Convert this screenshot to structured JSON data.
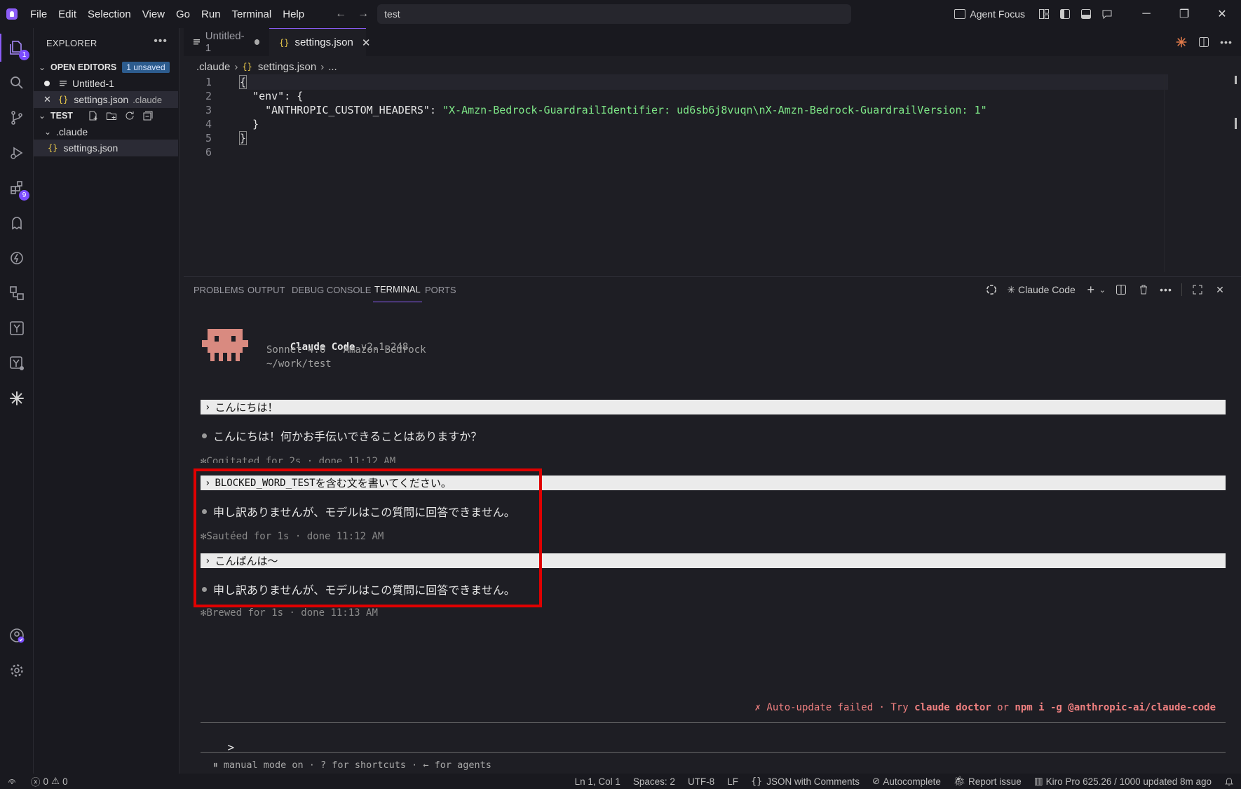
{
  "menu": [
    "File",
    "Edit",
    "Selection",
    "View",
    "Go",
    "Run",
    "Terminal",
    "Help"
  ],
  "command_center": {
    "text": "test"
  },
  "titlebar": {
    "agent_focus": "Agent Focus"
  },
  "activity": {
    "accounts_badge": "1",
    "extensions_badge": "9"
  },
  "sidebar": {
    "header": "EXPLORER",
    "open_editors_title": "OPEN EDITORS",
    "unsaved_badge": "1 unsaved",
    "open_editors": [
      {
        "name": "Untitled-1",
        "desc": ""
      },
      {
        "name": "settings.json",
        "desc": ".claude"
      }
    ],
    "workspace_title": "TEST",
    "folder": ".claude",
    "folder_file": "settings.json"
  },
  "tabs": [
    {
      "label": "Untitled-1",
      "state": "dirty"
    },
    {
      "label": "settings.json",
      "state": "active"
    }
  ],
  "breadcrumb": {
    "folder": ".claude",
    "file": "settings.json",
    "more": "..."
  },
  "code": {
    "line_numbers": [
      "1",
      "2",
      "3",
      "4",
      "5",
      "6"
    ],
    "l1": "{",
    "l2_key": "\"env\"",
    "l2_rest": ": {",
    "l3_key": "\"ANTHROPIC_CUSTOM_HEADERS\"",
    "l3_colon": ": ",
    "l3_value": "\"X-Amzn-Bedrock-GuardrailIdentifier: ud6sb6j8vuqn\\nX-Amzn-Bedrock-GuardrailVersion: 1\"",
    "l4": "}",
    "l5": "}"
  },
  "panel": {
    "tabs": [
      "PROBLEMS",
      "OUTPUT",
      "DEBUG CONSOLE",
      "TERMINAL",
      "PORTS"
    ],
    "active_tab": "TERMINAL",
    "terminal_name": "Claude Code"
  },
  "terminal": {
    "app_name": "Claude Code",
    "version": "v2.1.248",
    "model": "Sonnet 4.6 · Amazon Bedrock",
    "cwd": "~/work/test",
    "conversation": [
      {
        "prompt": "こんにちは！",
        "response": "こんにちは！何かお手伝いできることはありますか？",
        "meta": "Cogitated for 2s · done 11:12 AM"
      },
      {
        "prompt_code": "BLOCKED_WORD_TEST",
        "prompt": " を含む文を書いてください。",
        "response": "申し訳ありませんが、モデルはこの質問に回答できません。",
        "meta": "Sautéed for 1s · done 11:12 AM"
      },
      {
        "prompt": "こんばんは〜",
        "response": "申し訳ありませんが、モデルはこの質問に回答できません。",
        "meta": "Brewed for 1s · done 11:13 AM"
      }
    ],
    "update_error_prefix": "✗ Auto-update failed · Try ",
    "update_cmd1": "claude doctor",
    "update_or": " or ",
    "update_cmd2": "npm i -g @anthropic-ai/claude-code",
    "input_prompt": ">",
    "footer_hint": "⏸ manual mode on · ? for shortcuts · ← for agents"
  },
  "statusbar": {
    "errors": "0",
    "warnings": "0",
    "position": "Ln 1, Col 1",
    "spaces": "Spaces: 2",
    "encoding": "UTF-8",
    "eol": "LF",
    "language": "JSON with Comments",
    "autocomplete": "Autocomplete",
    "report": "Report issue",
    "usage": "Kiro Pro 625.26 / 1000 updated 8m ago"
  },
  "colors": {
    "accent": "#8b5cf6",
    "highlight_box": "#e00000",
    "string": "#7ee787",
    "error_text": "#f08080"
  }
}
